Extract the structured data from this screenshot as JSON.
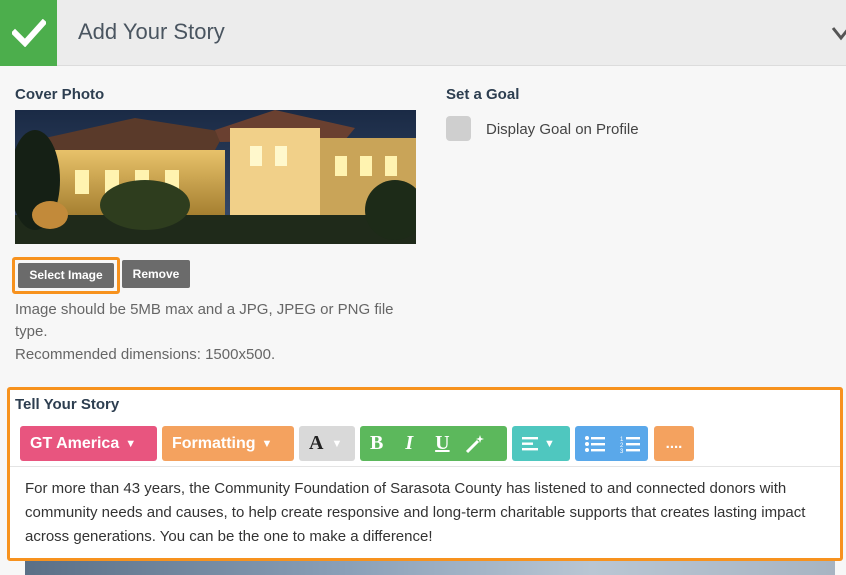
{
  "header": {
    "title": "Add Your Story",
    "check_icon": "check-icon",
    "collapse_icon": "chevron-down-icon"
  },
  "cover": {
    "label": "Cover Photo",
    "select_label": "Select Image",
    "remove_label": "Remove",
    "hint_line1": "Image should be 5MB max and a JPG, JPEG or PNG file",
    "hint_line2": "type.",
    "hint_line3": "Recommended dimensions: 1500x500."
  },
  "goal": {
    "label": "Set a Goal",
    "checkbox_label": "Display Goal on Profile",
    "checked": false
  },
  "story": {
    "label": "Tell Your Story",
    "toolbar": {
      "font": "GT America",
      "formatting": "Formatting",
      "more": "....",
      "icons": [
        "font-color-icon",
        "bold-icon",
        "italic-icon",
        "underline-icon",
        "magic-wand-icon",
        "align-icon",
        "bullet-list-icon",
        "numbered-list-icon"
      ]
    },
    "text": "For more than 43 years, the Community Foundation of Sarasota County has listened to and connected donors with community needs and causes, to help create responsive and long-term charitable supports that creates lasting impact across generations. You can be the one to make a difference!"
  },
  "colors": {
    "accent": "#f7921e",
    "success": "#4cae4c",
    "pink": "#e8557f",
    "orange": "#f4a25f",
    "teal": "#4fc7bf",
    "blue": "#5aa8ea"
  }
}
